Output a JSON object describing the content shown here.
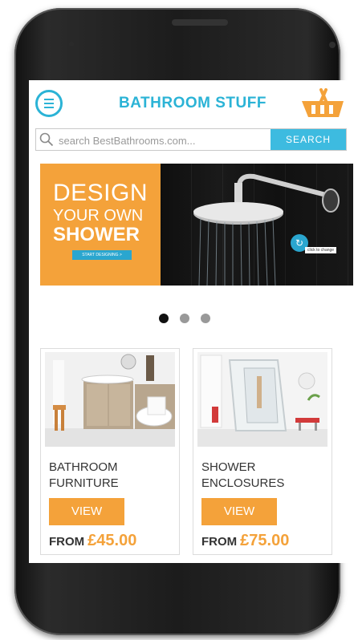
{
  "header": {
    "title": "BATHROOM STUFF",
    "menu_icon": "menu-icon",
    "basket_icon": "basket-icon"
  },
  "search": {
    "placeholder": "search BestBathrooms.com...",
    "button_label": "SEARCH",
    "icon": "search-icon"
  },
  "banner": {
    "line1": "DESIGN",
    "line2": "YOUR OWN",
    "line3": "SHOWER",
    "cta_label": "START DESIGNING >",
    "change_label": "click to change"
  },
  "carousel": {
    "dots": 3,
    "active_index": 0
  },
  "products": [
    {
      "name_line1": "BATHROOM",
      "name_line2": "FURNITURE",
      "view_label": "VIEW",
      "from_label": "FROM",
      "price": "£45.00"
    },
    {
      "name_line1": "SHOWER",
      "name_line2": "ENCLOSURES",
      "view_label": "VIEW",
      "from_label": "FROM",
      "price": "£75.00"
    }
  ],
  "colors": {
    "accent_blue": "#2bb3d6",
    "accent_orange": "#f4a23a"
  }
}
